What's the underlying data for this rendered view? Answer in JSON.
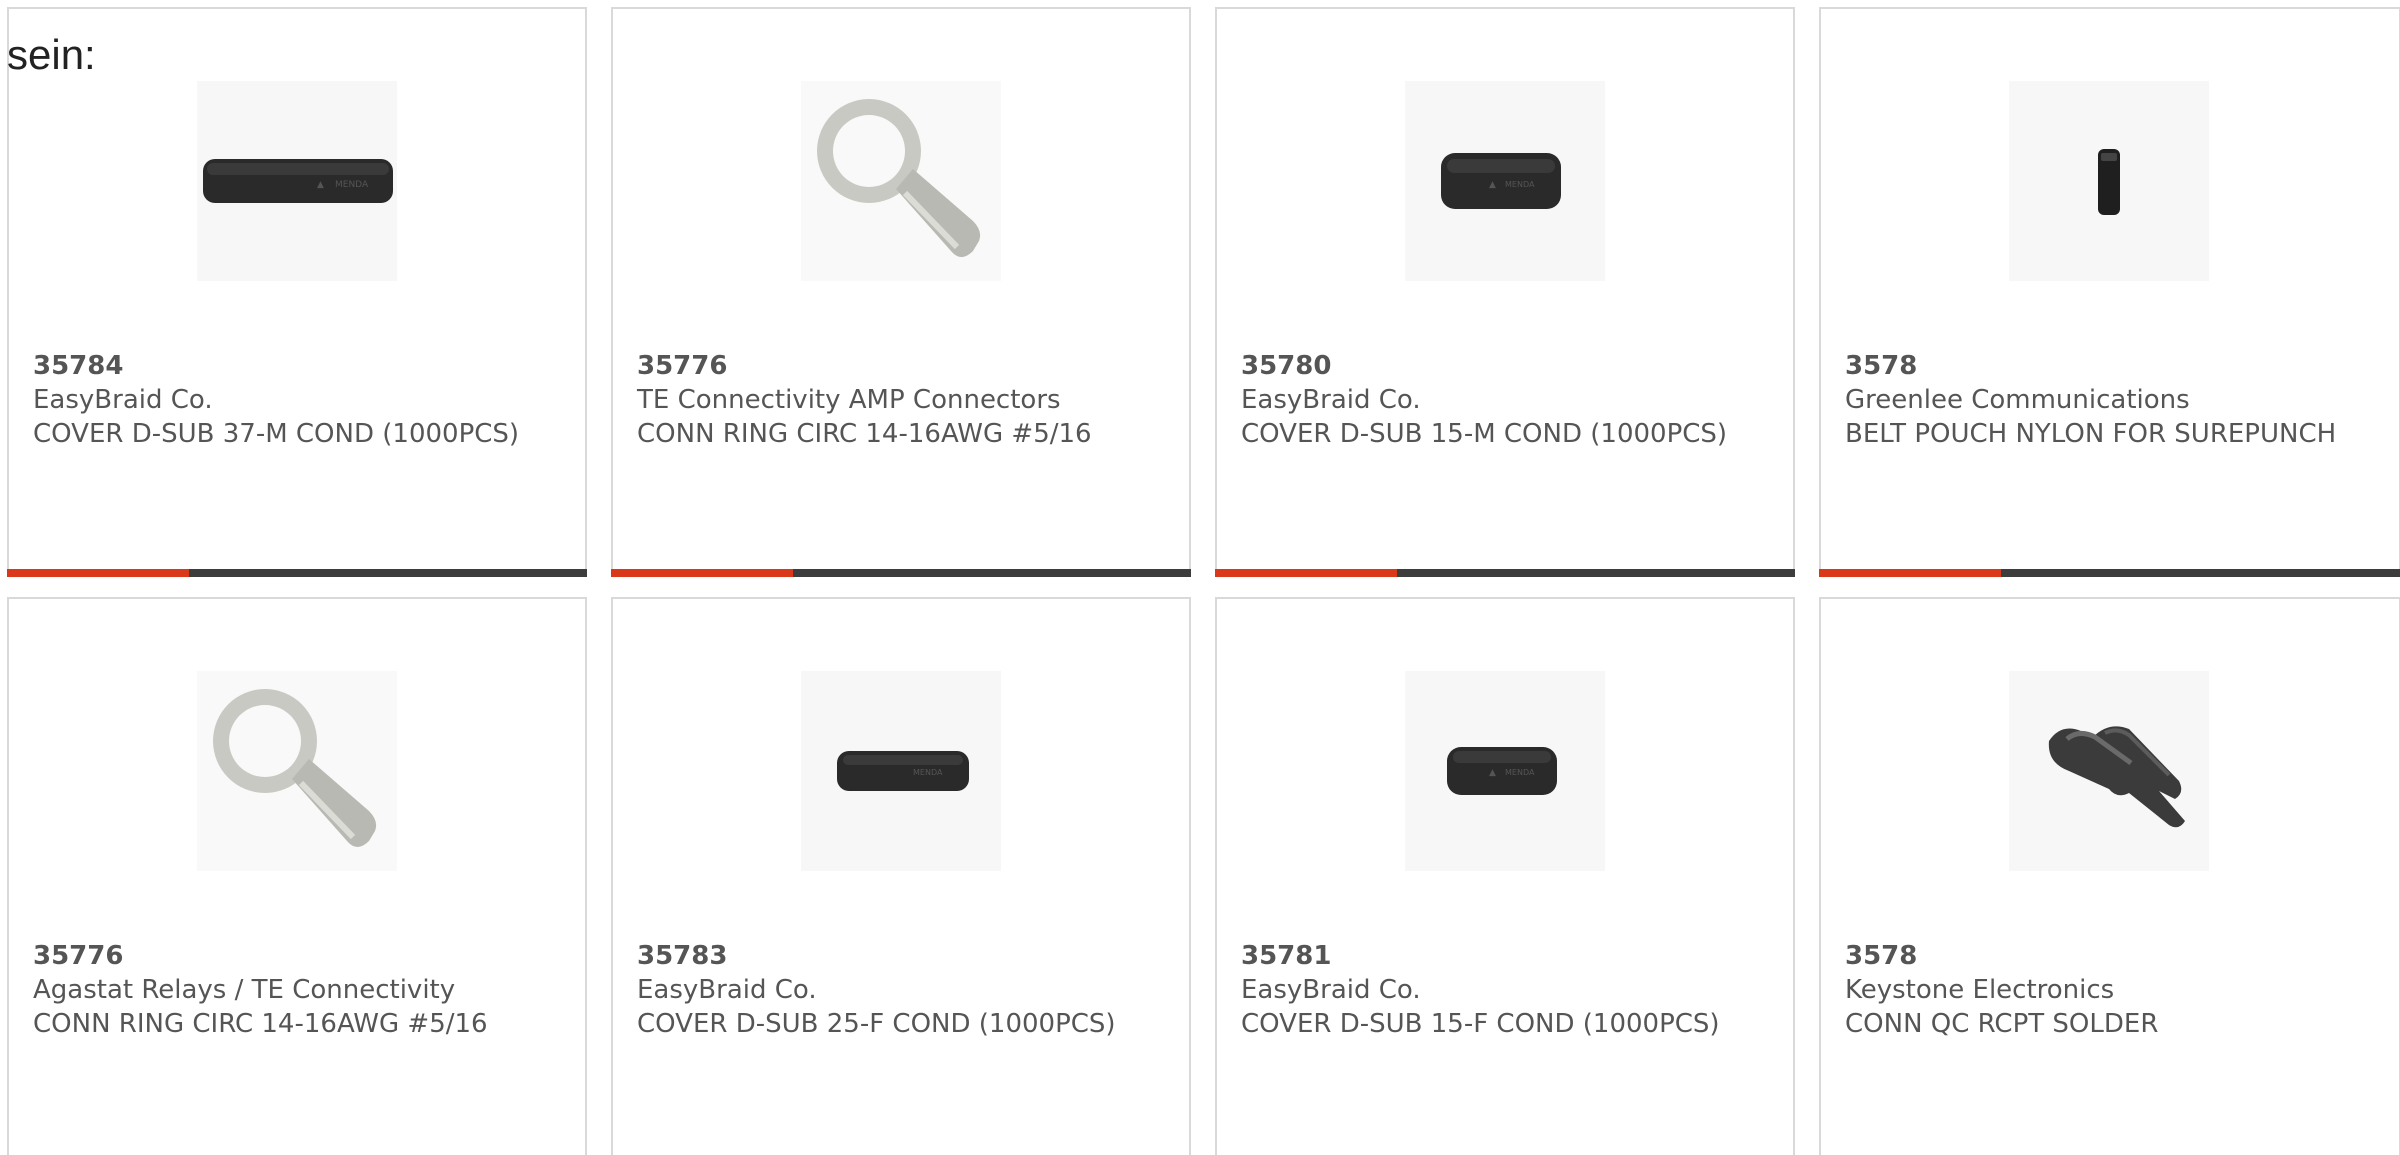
{
  "intro_text": "sein:",
  "colors": {
    "accent": "#d9391a",
    "bar": "#3d3d3d",
    "text": "#555555",
    "border": "#d9d9d9"
  },
  "products": [
    {
      "part": "35784",
      "manufacturer": "EasyBraid Co.",
      "description": "COVER D-SUB 37-M COND (1000PCS)",
      "image_icon": "dsub-cover-long-icon"
    },
    {
      "part": "35776",
      "manufacturer": "TE Connectivity AMP Connectors",
      "description": "CONN RING CIRC 14-16AWG #5/16",
      "image_icon": "ring-terminal-icon"
    },
    {
      "part": "35780",
      "manufacturer": "EasyBraid Co.",
      "description": "COVER D-SUB 15-M COND (1000PCS)",
      "image_icon": "dsub-cover-short-icon"
    },
    {
      "part": "3578",
      "manufacturer": "Greenlee Communications",
      "description": "BELT POUCH NYLON FOR SUREPUNCH",
      "image_icon": "belt-pouch-icon"
    },
    {
      "part": "35776",
      "manufacturer": "Agastat Relays / TE Connectivity",
      "description": "CONN RING CIRC 14-16AWG #5/16",
      "image_icon": "ring-terminal-icon"
    },
    {
      "part": "35783",
      "manufacturer": "EasyBraid Co.",
      "description": "COVER D-SUB 25-F COND (1000PCS)",
      "image_icon": "dsub-cover-medium-icon"
    },
    {
      "part": "35781",
      "manufacturer": "EasyBraid Co.",
      "description": "COVER D-SUB 15-F COND (1000PCS)",
      "image_icon": "dsub-cover-short-icon"
    },
    {
      "part": "3578",
      "manufacturer": "Keystone Electronics",
      "description": "CONN QC RCPT SOLDER",
      "image_icon": "qc-receptacle-icon"
    }
  ]
}
